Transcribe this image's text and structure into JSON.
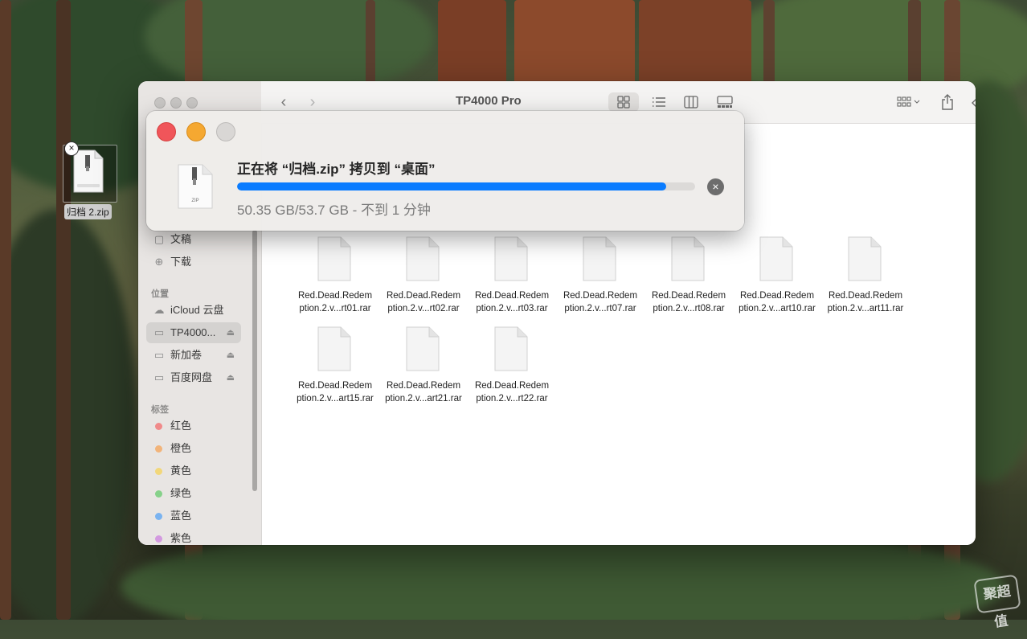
{
  "desktop": {
    "icon_label": "归档 2.zip",
    "watermark": "聚超值"
  },
  "finder": {
    "title": "TP4000 Pro",
    "sidebar": {
      "favorites": [
        {
          "label": "文稿",
          "icon": "document-icon"
        },
        {
          "label": "下载",
          "icon": "download-icon"
        }
      ],
      "locations_header": "位置",
      "locations": [
        {
          "label": "iCloud 云盘",
          "icon": "cloud-icon",
          "eject": false
        },
        {
          "label": "TP4000...",
          "icon": "drive-icon",
          "eject": true,
          "selected": true
        },
        {
          "label": "新加卷",
          "icon": "drive-icon",
          "eject": true
        },
        {
          "label": "百度网盘",
          "icon": "drive-icon",
          "eject": true
        }
      ],
      "tags_header": "标签",
      "tags": [
        {
          "label": "红色",
          "color": "#f08a8a"
        },
        {
          "label": "橙色",
          "color": "#f2b47a"
        },
        {
          "label": "黄色",
          "color": "#f2d77a"
        },
        {
          "label": "绿色",
          "color": "#86d18a"
        },
        {
          "label": "蓝色",
          "color": "#7ab3f0"
        },
        {
          "label": "紫色",
          "color": "#d39ae0"
        }
      ]
    },
    "files": [
      {
        "line1": "Red.Dead.Redem",
        "line2": "ption.2.v...rt01.rar"
      },
      {
        "line1": "Red.Dead.Redem",
        "line2": "ption.2.v...rt02.rar"
      },
      {
        "line1": "Red.Dead.Redem",
        "line2": "ption.2.v...rt03.rar"
      },
      {
        "line1": "Red.Dead.Redem",
        "line2": "ption.2.v...rt07.rar"
      },
      {
        "line1": "Red.Dead.Redem",
        "line2": "ption.2.v...rt08.rar"
      },
      {
        "line1": "Red.Dead.Redem",
        "line2": "ption.2.v...art10.rar"
      },
      {
        "line1": "Red.Dead.Redem",
        "line2": "ption.2.v...art11.rar"
      },
      {
        "line1": "Red.Dead.Redem",
        "line2": "ption.2.v...art15.rar"
      },
      {
        "line1": "Red.Dead.Redem",
        "line2": "ption.2.v...art21.rar"
      },
      {
        "line1": "Red.Dead.Redem",
        "line2": "ption.2.v...rt22.rar"
      }
    ]
  },
  "copy_dialog": {
    "title": "正在将 “归档.zip” 拷贝到 “桌面”",
    "status": "50.35 GB/53.7 GB - 不到 1 分钟",
    "progress_percent": 93.7,
    "icon_label": "ZIP",
    "accent_color": "#0a7cff"
  }
}
